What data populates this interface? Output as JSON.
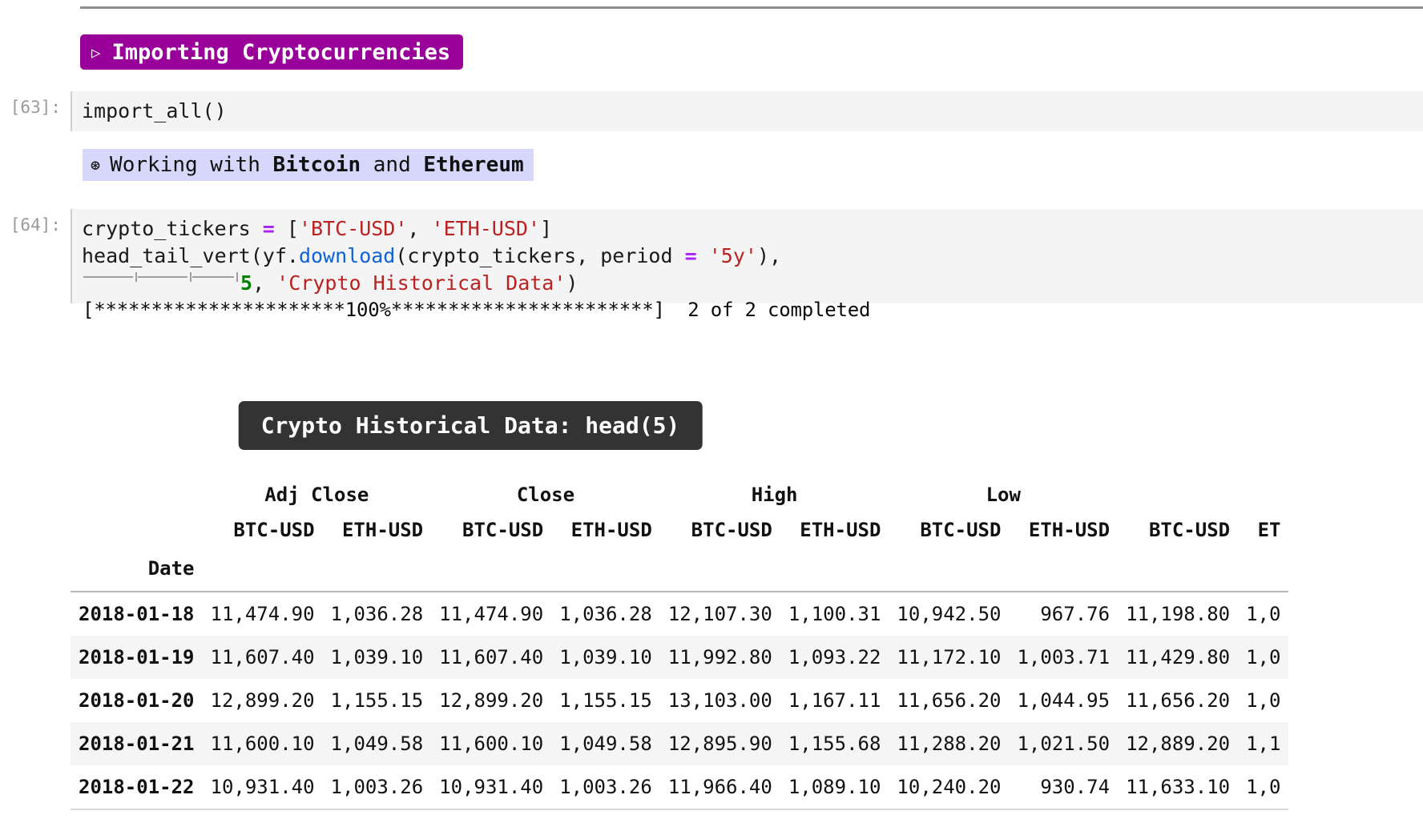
{
  "notebook": {
    "heading_primary": {
      "marker": "▷",
      "text": "Importing Cryptocurrencies",
      "bg_color": "#990099",
      "fg_color": "#ffffff"
    },
    "heading_secondary": {
      "marker": "⊛",
      "text_before": "Working with ",
      "bold_1": "Bitcoin",
      "text_middle": " and ",
      "bold_2": "Ethereum",
      "bg_color": "#d7d7fb"
    },
    "cells": [
      {
        "prompt": "[63]:",
        "source": "import_all()"
      },
      {
        "prompt": "[64]:",
        "line1": {
          "name": "crypto_tickers ",
          "op": "=",
          "rest_open": " [",
          "str1": "'BTC-USD'",
          "comma": ", ",
          "str2": "'ETH-USD'",
          "close": "]"
        },
        "line2": {
          "pre": "head_tail_vert(yf.",
          "fn": "download",
          "mid": "(crypto_tickers, period ",
          "op": "=",
          "sp": " ",
          "str": "'5y'",
          "post": "),"
        },
        "line3": {
          "num": "5",
          "comma": ", ",
          "str": "'Crypto Historical Data'",
          "close": ")"
        }
      }
    ],
    "stdout": "[**********************100%***********************]  2 of 2 completed",
    "table_title": "Crypto Historical Data: head(5)"
  },
  "chart_data": {
    "type": "table",
    "title": "Crypto Historical Data: head(5)",
    "index_name": "Date",
    "column_groups": [
      "Adj Close",
      "Close",
      "High",
      "Low",
      "",
      ""
    ],
    "group_spans": [
      2,
      2,
      2,
      2,
      2
    ],
    "tickers": [
      "BTC-USD",
      "ETH-USD",
      "BTC-USD",
      "ETH-USD",
      "BTC-USD",
      "ETH-USD",
      "BTC-USD",
      "ETH-USD",
      "BTC-USD",
      "ETH-USD"
    ],
    "last_group_label": "",
    "last_ticker_partial": "ET",
    "rows": [
      {
        "date": "2018-01-18",
        "values": [
          "11,474.90",
          "1,036.28",
          "11,474.90",
          "1,036.28",
          "12,107.30",
          "1,100.31",
          "10,942.50",
          "967.76",
          "11,198.80",
          "1,0"
        ]
      },
      {
        "date": "2018-01-19",
        "values": [
          "11,607.40",
          "1,039.10",
          "11,607.40",
          "1,039.10",
          "11,992.80",
          "1,093.22",
          "11,172.10",
          "1,003.71",
          "11,429.80",
          "1,0"
        ]
      },
      {
        "date": "2018-01-20",
        "values": [
          "12,899.20",
          "1,155.15",
          "12,899.20",
          "1,155.15",
          "13,103.00",
          "1,167.11",
          "11,656.20",
          "1,044.95",
          "11,656.20",
          "1,0"
        ]
      },
      {
        "date": "2018-01-21",
        "values": [
          "11,600.10",
          "1,049.58",
          "11,600.10",
          "1,049.58",
          "12,895.90",
          "1,155.68",
          "11,288.20",
          "1,021.50",
          "12,889.20",
          "1,1"
        ]
      },
      {
        "date": "2018-01-22",
        "values": [
          "10,931.40",
          "1,003.26",
          "10,931.40",
          "1,003.26",
          "11,966.40",
          "1,089.10",
          "10,240.20",
          "930.74",
          "11,633.10",
          "1,0"
        ]
      }
    ]
  }
}
